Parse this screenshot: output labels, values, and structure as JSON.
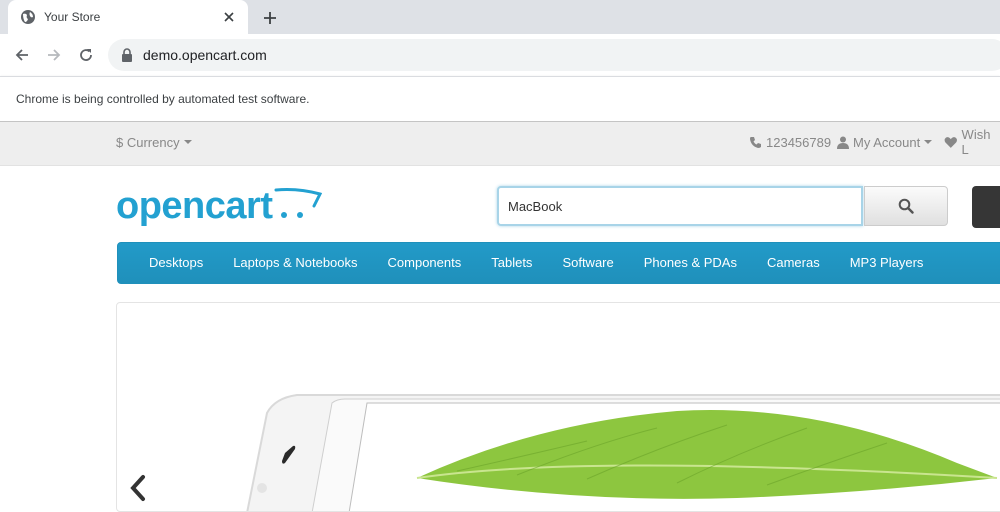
{
  "browser": {
    "tab_title": "Your Store",
    "url": "demo.opencart.com",
    "infobar_text": "Chrome is being controlled by automated test software."
  },
  "topbar": {
    "currency_label": "$ Currency",
    "phone": "123456789",
    "my_account_label": "My Account",
    "wishlist_label": "Wish L"
  },
  "header": {
    "logo_text": "opencart",
    "search_value": "MacBook"
  },
  "menu": {
    "items": [
      "Desktops",
      "Laptops & Notebooks",
      "Components",
      "Tablets",
      "Software",
      "Phones & PDAs",
      "Cameras",
      "MP3 Players"
    ]
  },
  "colors": {
    "brand": "#23a1d1",
    "menu_bg": "#229ac8",
    "topbar_bg": "#eeeeee",
    "leaf_green": "#8dc63f"
  }
}
